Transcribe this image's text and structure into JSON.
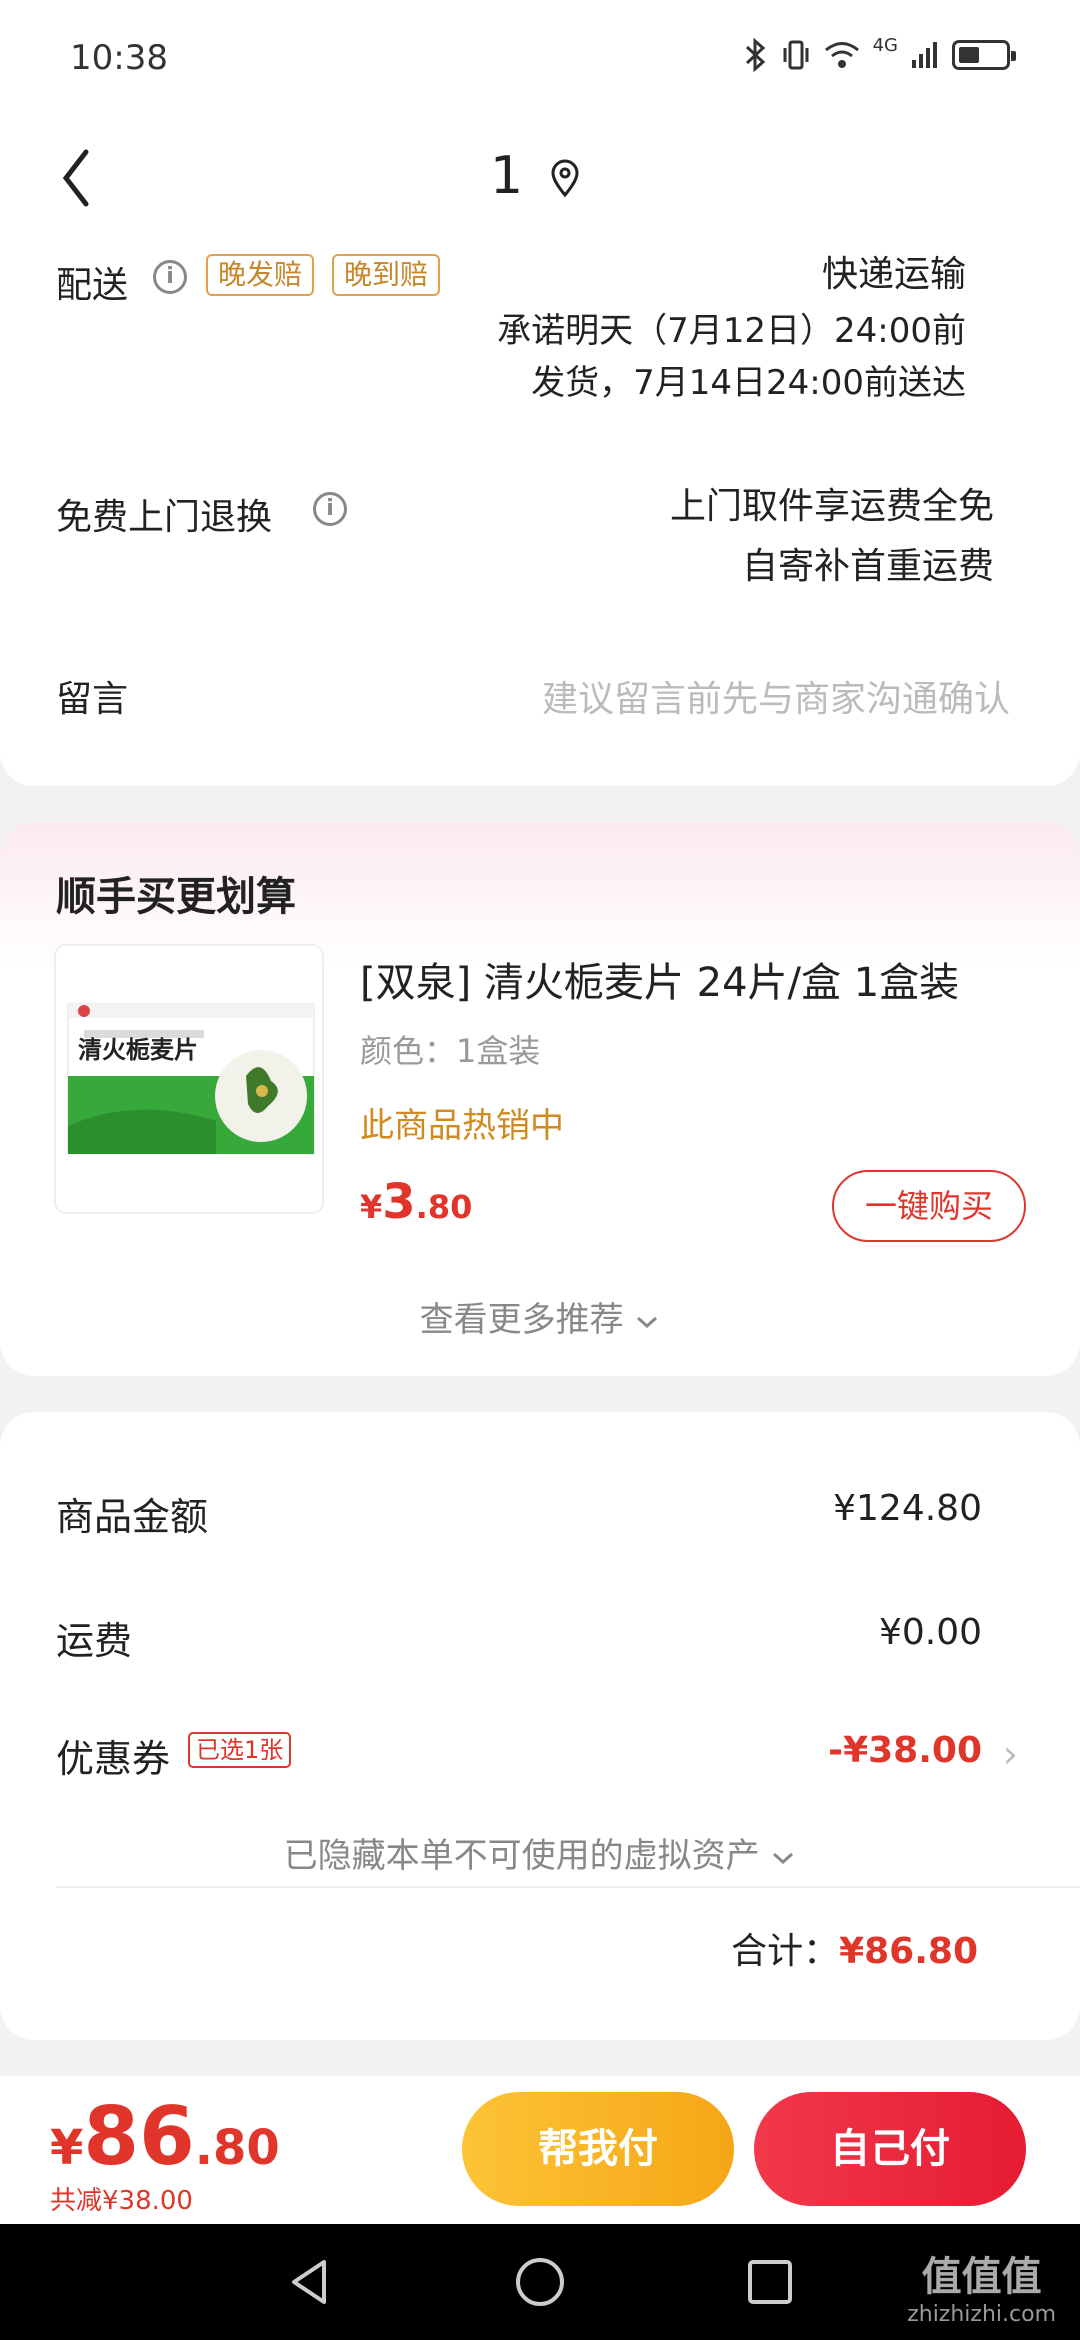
{
  "status_bar": {
    "time": "10:38",
    "network": "4G"
  },
  "nav": {
    "title": "1"
  },
  "delivery": {
    "label": "配送",
    "tags": [
      "晚发赔",
      "晚到赔"
    ],
    "method": "快递运输",
    "promise_line1": "承诺明天（7月12日）24:00前",
    "promise_line2": "发货，7月14日24:00前送达"
  },
  "returns": {
    "label": "免费上门退换",
    "line1": "上门取件享运费全免",
    "line2": "自寄补首重运费"
  },
  "message": {
    "label": "留言",
    "placeholder": "建议留言前先与商家沟通确认"
  },
  "recommend": {
    "heading": "顺手买更划算",
    "product": {
      "title": "[双泉] 清火栀麦片 24片/盒 1盒装",
      "spec": "颜色：1盒装",
      "hot": "此商品热销中",
      "price_symbol": "¥",
      "price_int": "3",
      "price_dec": ".80",
      "buy_label": "一键购买",
      "image_text": "清火栀麦片"
    },
    "see_more": "查看更多推荐"
  },
  "summary": {
    "goods_label": "商品金额",
    "goods_value": "¥124.80",
    "shipping_label": "运费",
    "shipping_value": "¥0.00",
    "coupon_label": "优惠券",
    "coupon_tag": "已选1张",
    "coupon_value": "-¥38.00",
    "hidden_assets": "已隐藏本单不可使用的虚拟资产",
    "total_label": "合计：",
    "total_value": "¥86.80"
  },
  "bottom": {
    "price_symbol": "¥",
    "price_int": "86",
    "price_dec": ".80",
    "saved": "共减¥38.00",
    "help_pay": "帮我付",
    "self_pay": "自己付"
  },
  "watermark": {
    "line1": "值值值",
    "line2": "zhizhizhi.com"
  },
  "colors": {
    "accent_red": "#e0352b",
    "accent_yellow": "#f5a617",
    "tag_orange": "#c8862a"
  }
}
